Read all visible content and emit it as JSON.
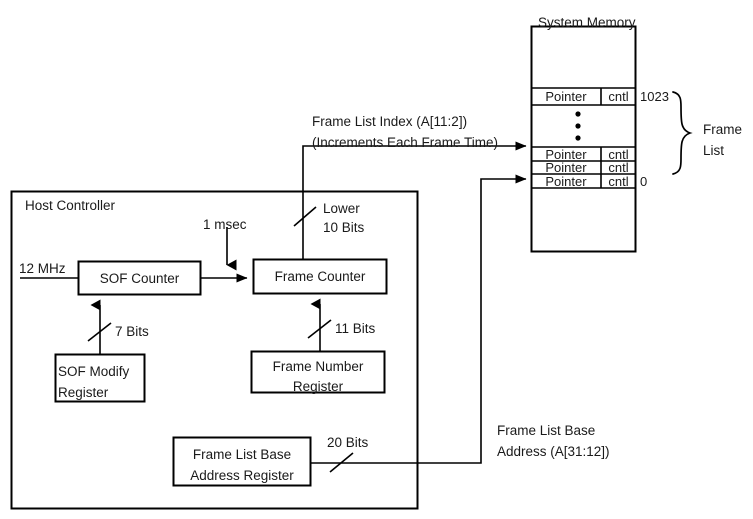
{
  "diagram": {
    "title_visible": false,
    "colors": {
      "line": "#000000",
      "text": "#1a1a1a",
      "background": "#ffffff",
      "box_fill": "#ffffff"
    },
    "host_controller": {
      "label": "Host Controller",
      "blocks": [
        {
          "id": "sof-counter",
          "label": "SOF Counter"
        },
        {
          "id": "frame-counter",
          "label": "Frame Counter"
        },
        {
          "id": "sof-modify-register",
          "line1": "SOF Modify",
          "line2": "Register"
        },
        {
          "id": "frame-number-register",
          "line1": "Frame Number",
          "line2": "Register"
        },
        {
          "id": "frame-list-base-address-register",
          "line1": "Frame List Base",
          "line2": "Address Register"
        }
      ],
      "signals": {
        "clock_input": "12 MHz",
        "tick": "1 msec",
        "sof_modify_width": "7 Bits",
        "frame_number_width": "11 Bits",
        "frame_counter_tap_line1": "Lower",
        "frame_counter_tap_line2": "10 Bits",
        "base_address_width": "20 Bits"
      }
    },
    "annotations": {
      "frame_list_index_line1": "Frame List Index  (A[11:2])",
      "frame_list_index_line2": "(Increments Each Frame Time)",
      "frame_list_base_line1": "Frame List Base",
      "frame_list_base_line2": "Address (A[31:12])"
    },
    "system_memory": {
      "title": "System Memory",
      "rows": [
        {
          "pointer": "Pointer",
          "cntl": "cntl",
          "index": "1023"
        },
        {
          "pointer": "Pointer",
          "cntl": "cntl",
          "index": ""
        },
        {
          "pointer": "Pointer",
          "cntl": "cntl",
          "index": ""
        },
        {
          "pointer": "Pointer",
          "cntl": "cntl",
          "index": "0"
        }
      ],
      "ellipsis": "vertical-dots",
      "brace_label_line1": "Frame",
      "brace_label_line2": "List"
    }
  }
}
